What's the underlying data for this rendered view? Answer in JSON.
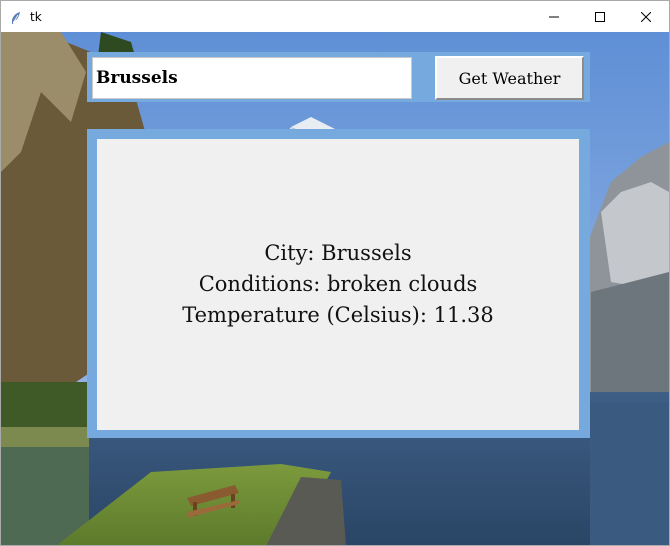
{
  "window": {
    "title": "tk",
    "icon": "feather-icon",
    "controls": [
      "minimize-icon",
      "maximize-icon",
      "close-icon"
    ]
  },
  "search": {
    "city_value": "Brussels",
    "button_label": "Get Weather"
  },
  "result": {
    "city_line": "City: Brussels",
    "conditions_line": "Conditions: broken clouds",
    "temperature_line": "Temperature (Celsius): 11.38"
  },
  "colors": {
    "frame_accent": "#76a9dd",
    "panel_bg": "#f0f0f0",
    "button_bg": "#f0f0f0"
  }
}
